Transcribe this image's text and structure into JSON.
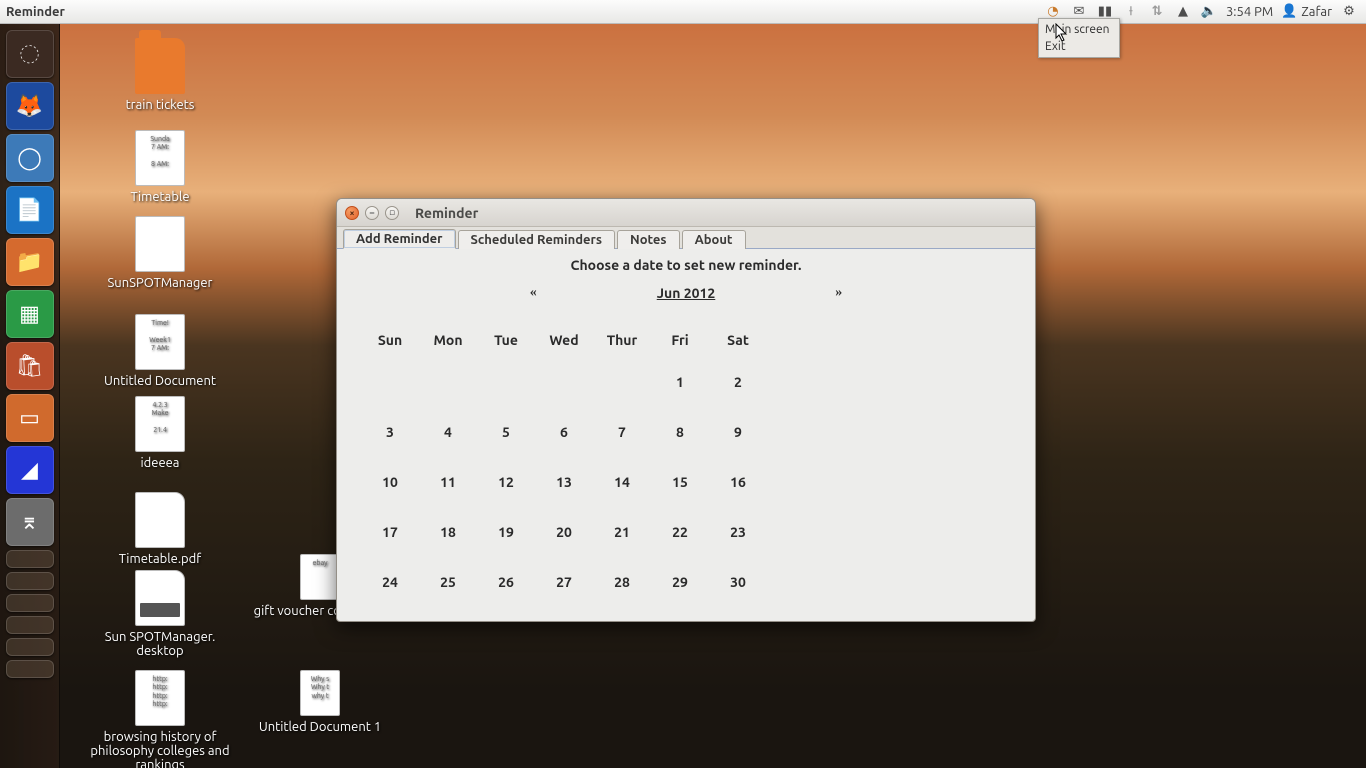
{
  "top_panel": {
    "app_title": "Reminder",
    "time": "3:54 PM",
    "user": "Zafar"
  },
  "dropdown": {
    "item1": "Main screen",
    "item2": "Exit"
  },
  "desktop_icons": {
    "train_tickets": "train tickets",
    "timetable": "Timetable",
    "sunspotmgr": "SunSPOTManager",
    "untitled_doc": "Untitled Document",
    "ideeea": "ideeea",
    "timetable_pdf": "Timetable.pdf",
    "sunspot_desktop": "Sun SPOTManager. desktop",
    "browsing_history": "browsing history of philosophy colleges and rankings",
    "gift_voucher": "gift voucher code ebay",
    "untitled_doc1": "Untitled Document 1"
  },
  "window": {
    "title": "Reminder",
    "tabs": {
      "add": "Add Reminder",
      "scheduled": "Scheduled Reminders",
      "notes": "Notes",
      "about": "About"
    },
    "prompt": "Choose a date to set new reminder.",
    "prev": "«",
    "next": "»",
    "month": "Jun 2012",
    "dow": {
      "sun": "Sun",
      "mon": "Mon",
      "tue": "Tue",
      "wed": "Wed",
      "thu": "Thur",
      "fri": "Fri",
      "sat": "Sat"
    },
    "weeks": [
      [
        "",
        "",
        "",
        "",
        "",
        "1",
        "2"
      ],
      [
        "3",
        "4",
        "5",
        "6",
        "7",
        "8",
        "9"
      ],
      [
        "10",
        "11",
        "12",
        "13",
        "14",
        "15",
        "16"
      ],
      [
        "17",
        "18",
        "19",
        "20",
        "21",
        "22",
        "23"
      ],
      [
        "24",
        "25",
        "26",
        "27",
        "28",
        "29",
        "30"
      ]
    ]
  },
  "launcher": {
    "items": [
      {
        "name": "dash",
        "bg": "#3b2a22",
        "glyph": "◌"
      },
      {
        "name": "firefox",
        "bg": "#1d4a9e",
        "glyph": "🦊"
      },
      {
        "name": "chromium",
        "bg": "#3d7ab8",
        "glyph": "◯"
      },
      {
        "name": "writer",
        "bg": "#1b73c5",
        "glyph": "📄"
      },
      {
        "name": "files",
        "bg": "#d56a2e",
        "glyph": "📁"
      },
      {
        "name": "calc",
        "bg": "#2a9a46",
        "glyph": "▦"
      },
      {
        "name": "software",
        "bg": "#b94e2c",
        "glyph": "🛍"
      },
      {
        "name": "impress",
        "bg": "#d06a2d",
        "glyph": "▭"
      },
      {
        "name": "ide",
        "bg": "#2436d6",
        "glyph": "◢"
      },
      {
        "name": "scanner",
        "bg": "#6c6c6c",
        "glyph": "⌆"
      }
    ]
  }
}
